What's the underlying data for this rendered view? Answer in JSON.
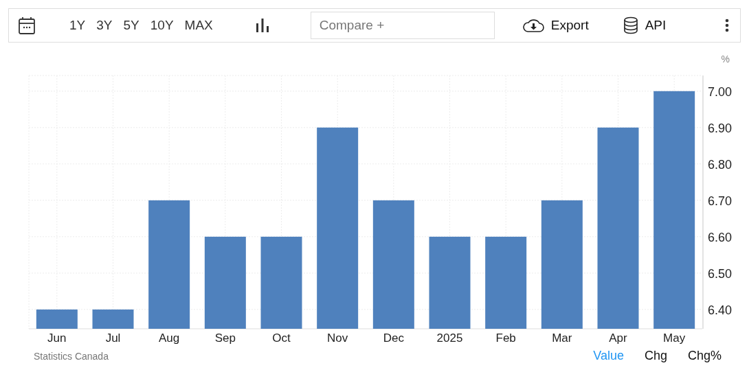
{
  "toolbar": {
    "ranges": [
      {
        "label": "1Y",
        "selected": false
      },
      {
        "label": "3Y",
        "selected": false
      },
      {
        "label": "5Y",
        "selected": false
      },
      {
        "label": "10Y",
        "selected": false
      },
      {
        "label": "MAX",
        "selected": false
      }
    ],
    "compare": {
      "placeholder": "Compare +"
    },
    "export": "Export",
    "api": "API"
  },
  "chart": {
    "unit": "%",
    "chart_data": {
      "type": "bar",
      "categories": [
        "Jun",
        "Jul",
        "Aug",
        "Sep",
        "Oct",
        "Nov",
        "Dec",
        "2025",
        "Feb",
        "Mar",
        "Apr",
        "May"
      ],
      "grid": true,
      "series": [
        {
          "color": "#4f81bd",
          "values": [
            6.4,
            6.4,
            6.7,
            6.6,
            6.6,
            6.9,
            6.7,
            6.6,
            6.6,
            6.7,
            6.9,
            7.0
          ]
        }
      ],
      "ylim": [
        6.347,
        7.043
      ],
      "yticks": [
        {
          "value": 6.4,
          "label": "6.40"
        },
        {
          "value": 6.5,
          "label": "6.50"
        },
        {
          "value": 6.6,
          "label": "6.60"
        },
        {
          "value": 6.7,
          "label": "6.70"
        },
        {
          "value": 6.8,
          "label": "6.80"
        },
        {
          "value": 6.9,
          "label": "6.90"
        },
        {
          "value": 7.0,
          "label": "7.00"
        }
      ]
    }
  },
  "footer": {
    "source": "Statistics Canada",
    "modes": [
      {
        "label": "Value",
        "selected": true
      },
      {
        "label": "Chg",
        "selected": false
      },
      {
        "label": "Chg%",
        "selected": false
      }
    ]
  }
}
